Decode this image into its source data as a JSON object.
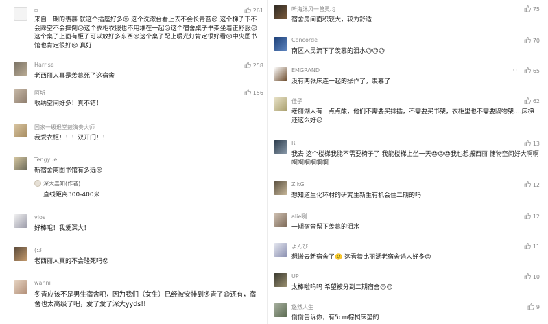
{
  "left": [
    {
      "user": "▫",
      "text": "来自一期的羡慕 就这个插座好多😥 这个洗漱台看上去不会长青苔😥 这个梯子下不会踩空不会摔倒😥这个衣柜衣服也不用堆在一起😥这个宿舍桌子书架坐着正舒服😥这个桌子上面有柜子可以放好多东西😥这个桌子配上暖光灯肯定很好看😥中央图书馆也肯定很好😥  真好",
      "likes": "261"
    },
    {
      "user": "Harrise",
      "text": "老西丽人真是羡慕死了这宿舍",
      "likes": "258"
    },
    {
      "user": "阿圻",
      "text": "收纳空间好多！真不错！",
      "likes": "156"
    },
    {
      "user": "国家一级退堂鼓演奏大师",
      "text": "我爱衣柜！！！双开门！！",
      "likes": ""
    },
    {
      "user": "Tengyue",
      "text": "新宿舍离图书馆有多远😥",
      "likes": "",
      "reply": {
        "name": "深大嘉知(作者)",
        "text": "直线距离300-400米"
      }
    },
    {
      "user": "vios",
      "text": "好棒哦！我爱深大！",
      "likes": ""
    },
    {
      "user": "(:3",
      "text": "老西丽人真的不会酸死吗😵",
      "likes": ""
    },
    {
      "user": "wanni",
      "text": "冬青应该不是男生宿舍吧，因为我们（女生）已经被安排到冬青了😄还有，宿舍也太高级了吧，爱了爱了深大yyds!!",
      "likes": ""
    }
  ],
  "right": [
    {
      "user": "听海沐风一曾灵均",
      "text": "宿舍房间面积较大，较为舒适",
      "likes": "75"
    },
    {
      "user": "Concorde",
      "text": "南区人民流下了羡慕的泪水😥😥😥",
      "likes": "70"
    },
    {
      "user": "EMGRAND",
      "text": "没有两张床连一起的操作了，羡慕了",
      "likes": "65"
    },
    {
      "user": "佳子",
      "text": "老丽湖人有一点点酸，他们不需要买排插，不需要买书架，衣柜里也不需要隔物架....床梯还这么好😥",
      "likes": "62"
    },
    {
      "user": "R",
      "text": "我去 这个楼梯我能不需要椅子了 我能楼梯上坐一天😍😍😍我也想搬西丽 储物空间好大啊啊啊啊啊啊啊啊",
      "likes": "13"
    },
    {
      "user": "ZikG",
      "text": "想知道生化环材的研究生新生有机会住二期的吗",
      "likes": "12"
    },
    {
      "user": "alie咧",
      "text": "一期宿舍留下羡慕的泪水",
      "likes": "12"
    },
    {
      "user": "よんぴ",
      "text": "想搬去新宿舍了🙂 这看着比丽湖老宿舍诱人好多😊",
      "likes": "11"
    },
    {
      "user": "UP",
      "text": "太棒啦呜呜 希望被分到二期宿舍😍😍",
      "likes": "10"
    },
    {
      "user": "悠然人生",
      "text": "偷偷告诉你，有5cm棕桐床垫的",
      "likes": "9"
    }
  ],
  "colors": {
    "muted": "#8a8a8a",
    "text": "#1f1f1f"
  }
}
